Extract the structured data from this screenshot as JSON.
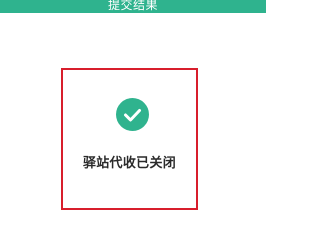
{
  "header": {
    "title": "提交结果"
  },
  "result": {
    "icon": "check-circle-icon",
    "message": "驿站代收已关闭"
  },
  "colors": {
    "accent": "#2fb38e",
    "highlight_border": "#d81e2c",
    "text": "#2a2a2a"
  }
}
